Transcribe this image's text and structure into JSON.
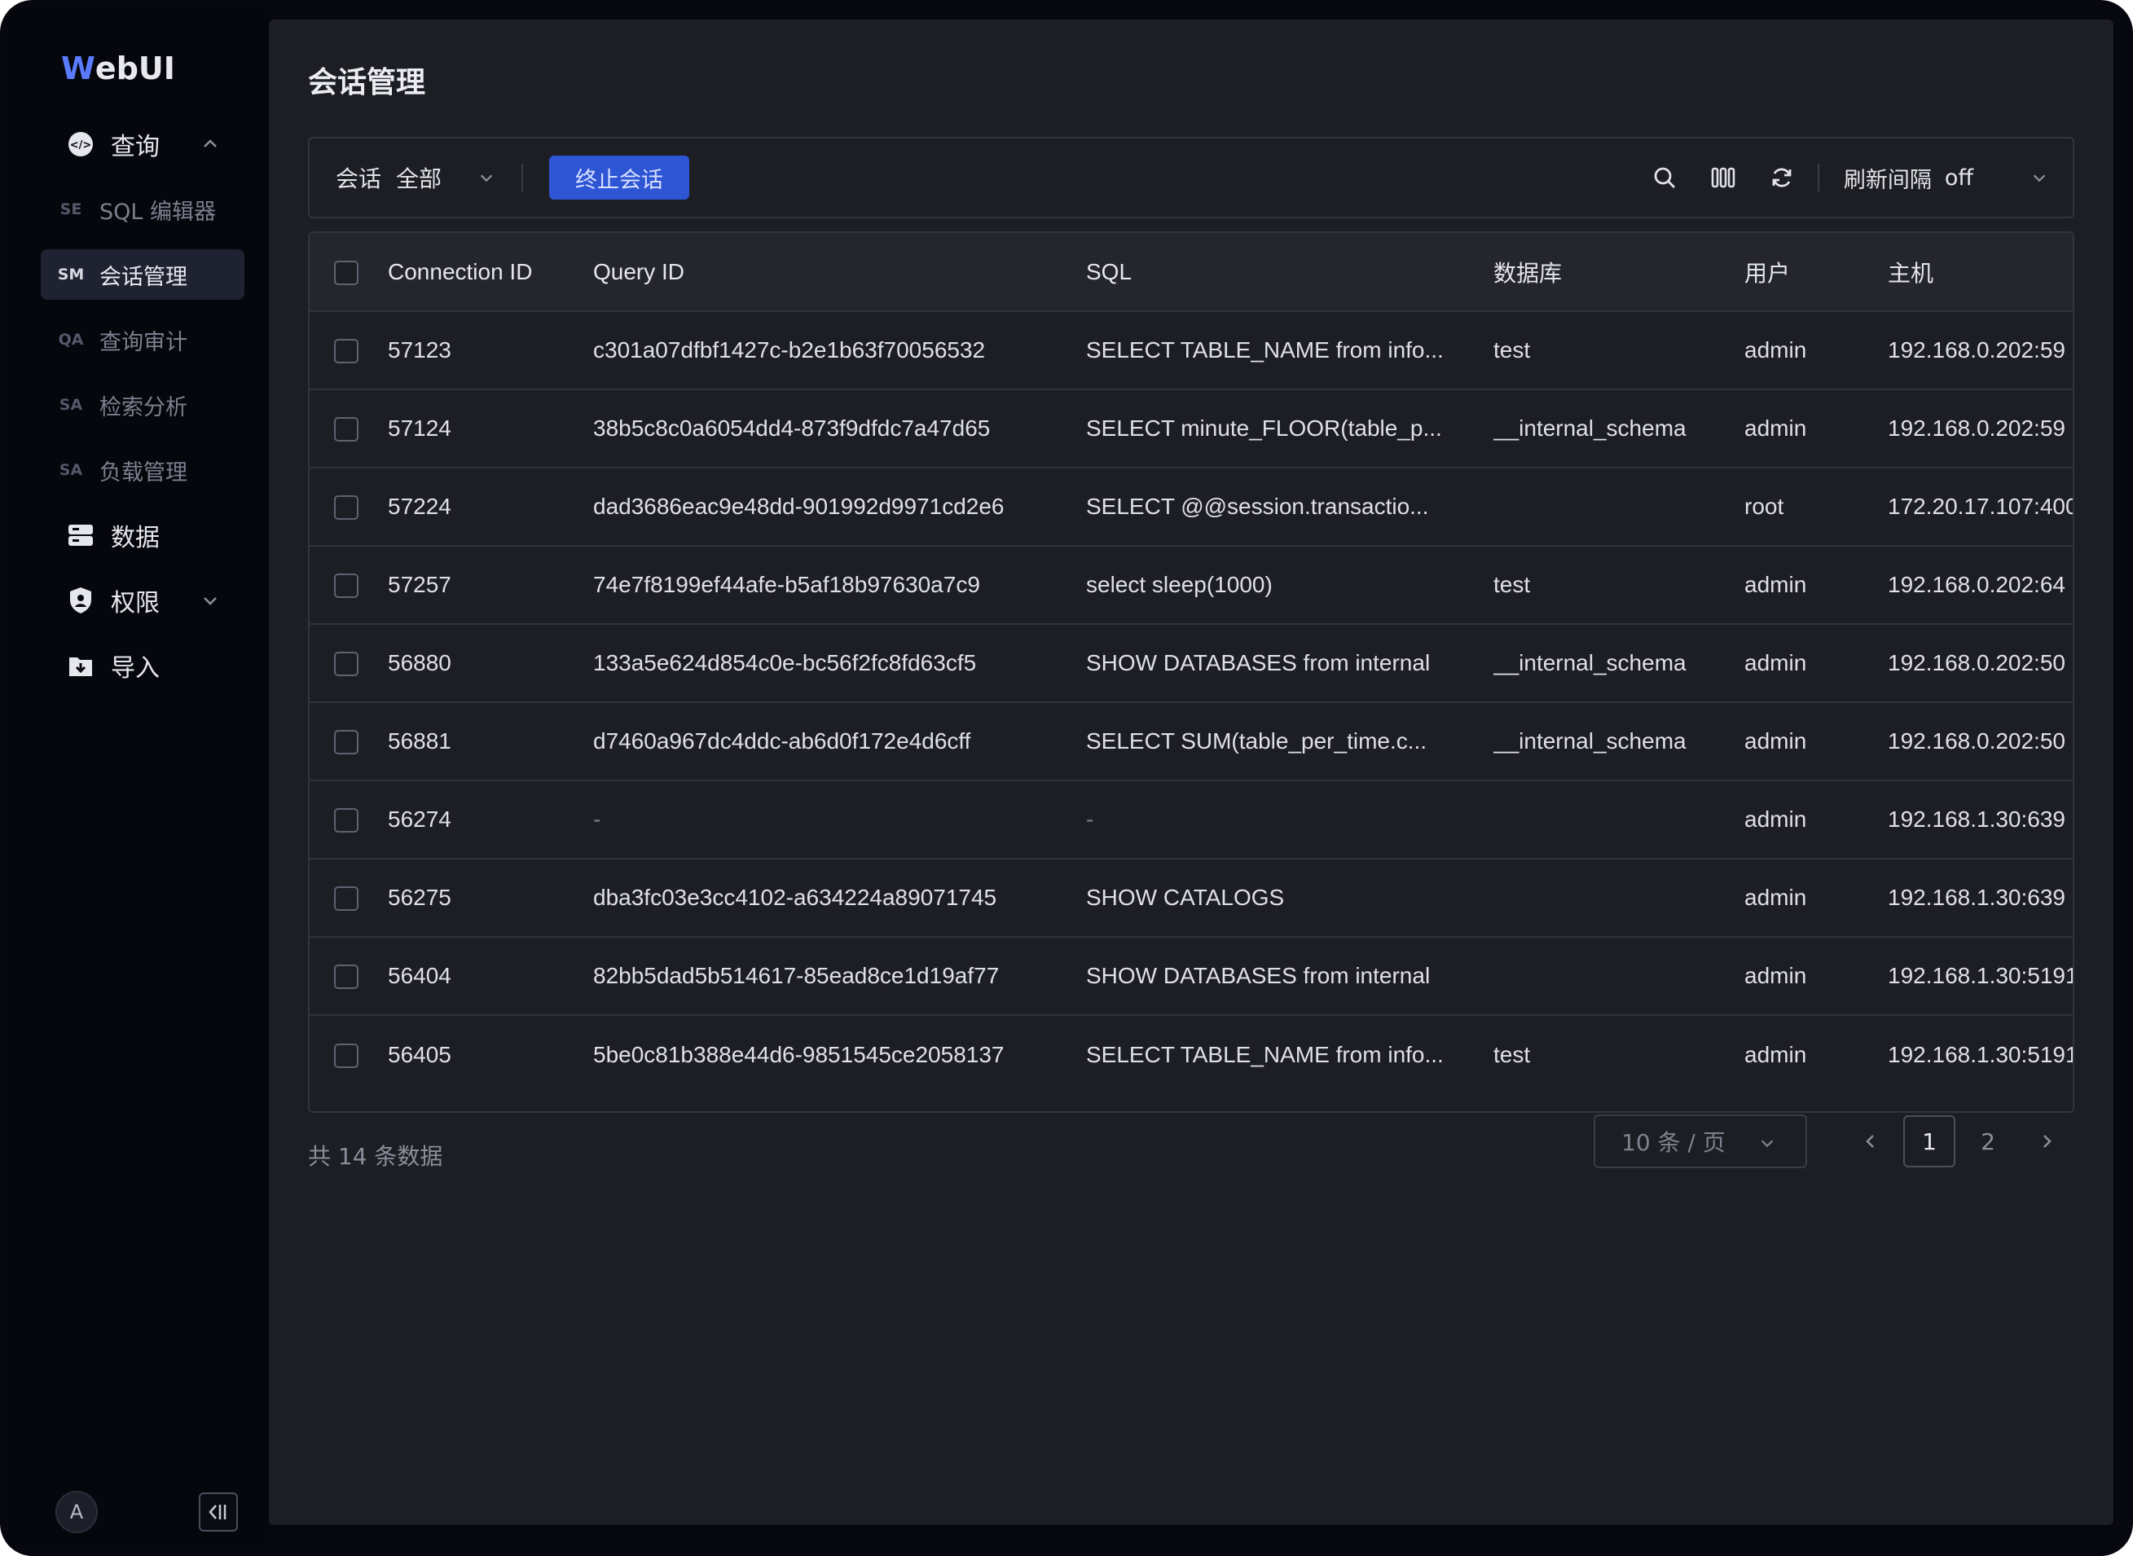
{
  "app": {
    "logo_prefix": "W",
    "logo_rest": "ebUI"
  },
  "sidebar": {
    "groups": [
      {
        "label": "查询",
        "icon": "query-icon"
      },
      {
        "label": "数据",
        "icon": "database-icon"
      },
      {
        "label": "权限",
        "icon": "shield-icon"
      },
      {
        "label": "导入",
        "icon": "import-icon"
      }
    ],
    "query_items": [
      {
        "abbr": "SE",
        "label": "SQL 编辑器"
      },
      {
        "abbr": "SM",
        "label": "会话管理"
      },
      {
        "abbr": "QA",
        "label": "查询审计"
      },
      {
        "abbr": "SA",
        "label": "检索分析"
      },
      {
        "abbr": "SA",
        "label": "负载管理"
      }
    ],
    "avatar": "A"
  },
  "page": {
    "title": "会话管理"
  },
  "toolbar": {
    "session_label": "会话",
    "session_value": "全部",
    "kill_button": "终止会话",
    "refresh_label": "刷新间隔",
    "refresh_value": "off"
  },
  "table": {
    "columns": [
      "Connection ID",
      "Query ID",
      "SQL",
      "数据库",
      "用户",
      "主机"
    ],
    "rows": [
      [
        "57123",
        "c301a07dfbf1427c-b2e1b63f70056532",
        "SELECT TABLE_NAME from info...",
        "test",
        "admin",
        "192.168.0.202:59"
      ],
      [
        "57124",
        "38b5c8c0a6054dd4-873f9dfdc7a47d65",
        "SELECT minute_FLOOR(table_p...",
        "__internal_schema",
        "admin",
        "192.168.0.202:59"
      ],
      [
        "57224",
        "dad3686eac9e48dd-901992d9971cd2e6",
        "SELECT @@session.transactio...",
        "",
        "root",
        "172.20.17.107:400"
      ],
      [
        "57257",
        "74e7f8199ef44afe-b5af18b97630a7c9",
        "select sleep(1000)",
        "test",
        "admin",
        "192.168.0.202:64"
      ],
      [
        "56880",
        "133a5e624d854c0e-bc56f2fc8fd63cf5",
        "SHOW DATABASES from internal",
        "__internal_schema",
        "admin",
        "192.168.0.202:50"
      ],
      [
        "56881",
        "d7460a967dc4ddc-ab6d0f172e4d6cff",
        "SELECT SUM(table_per_time.c...",
        "__internal_schema",
        "admin",
        "192.168.0.202:50"
      ],
      [
        "56274",
        "-",
        "-",
        "",
        "admin",
        "192.168.1.30:639"
      ],
      [
        "56275",
        "dba3fc03e3cc4102-a634224a89071745",
        "SHOW CATALOGS",
        "",
        "admin",
        "192.168.1.30:639"
      ],
      [
        "56404",
        "82bb5dad5b514617-85ead8ce1d19af77",
        "SHOW DATABASES from internal",
        "",
        "admin",
        "192.168.1.30:5191"
      ],
      [
        "56405",
        "5be0c81b388e44d6-9851545ce2058137",
        "SELECT TABLE_NAME from info...",
        "test",
        "admin",
        "192.168.1.30:5191"
      ]
    ]
  },
  "pagination": {
    "total_text": "共 14 条数据",
    "page_size": "10 条 / 页",
    "pages": [
      "1",
      "2"
    ],
    "current_page": "1"
  }
}
